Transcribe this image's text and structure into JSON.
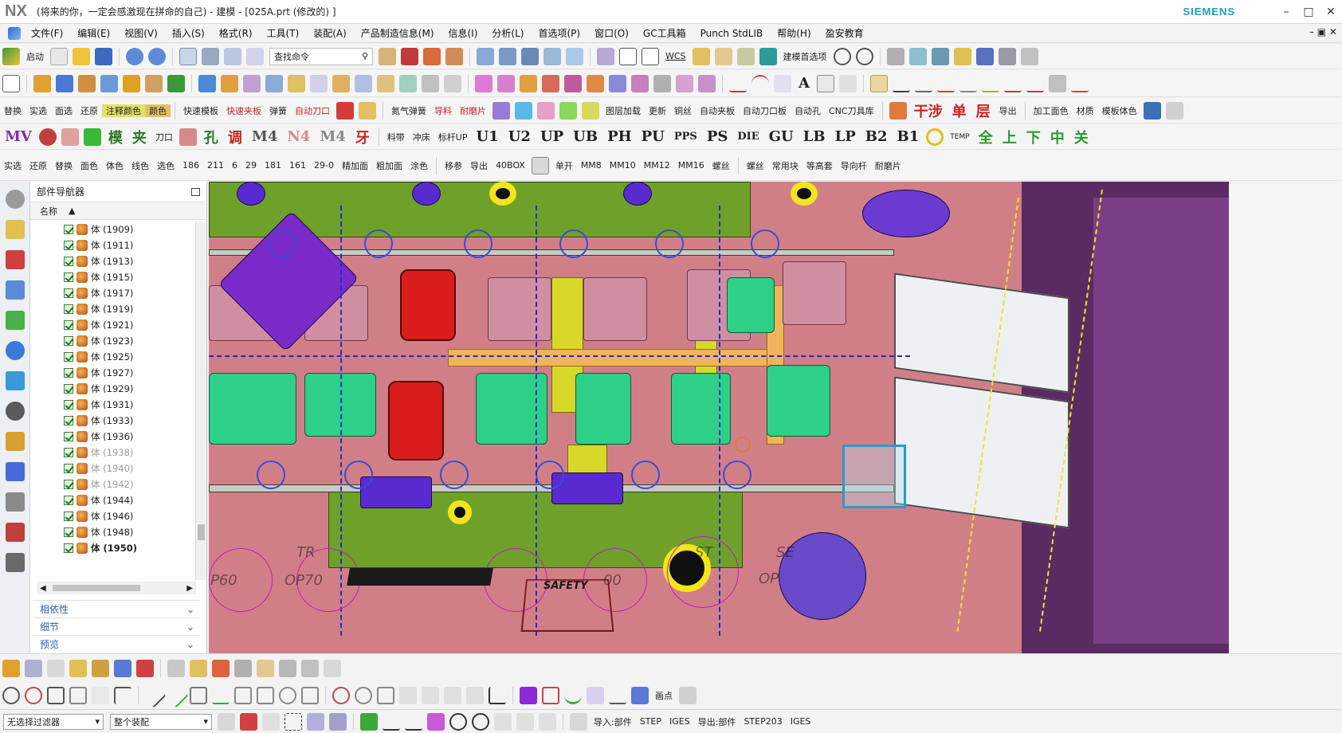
{
  "titlebar": {
    "logo": "NX",
    "title": "(将来的你，一定会感激现在拼命的自己) - 建模 - [025A.prt  (修改的) ]",
    "brand": "SIEMENS",
    "minimize": "–",
    "maximize": "□",
    "close": "✕"
  },
  "menu": {
    "items": [
      "文件(F)",
      "编辑(E)",
      "视图(V)",
      "插入(S)",
      "格式(R)",
      "工具(T)",
      "装配(A)",
      "产品制造信息(M)",
      "信息(I)",
      "分析(L)",
      "首选项(P)",
      "窗口(O)",
      "GC工具箱",
      "Punch StdLIB",
      "帮助(H)",
      "盈安教育"
    ],
    "restore": "– ▣ ✕"
  },
  "toolbar1": {
    "start_label": "启动",
    "search_placeholder": "查找命令",
    "wcs_label": "WCS",
    "prefs_label": "建模首选项"
  },
  "toolbar3": {
    "labels": [
      "替换",
      "实选",
      "面选",
      "还原",
      "注释颜色",
      "颜色",
      "快速模板",
      "快速夹板",
      "弹簧",
      "自动刀口",
      "氮气弹簧",
      "导料",
      "耐磨片",
      "图层加载",
      "更新",
      "铜丝",
      "自动夹板",
      "自动刀口板",
      "自动孔",
      "CNC刀具库",
      "干涉",
      "单",
      "层",
      "导出",
      "加工面色",
      "材质",
      "模板体色"
    ]
  },
  "toolbar4": {
    "labels": [
      "MV",
      "模",
      "夹",
      "刀口",
      "调",
      "M4",
      "N4",
      "M4",
      "孔",
      "牙",
      "料带",
      "冲床",
      "标杆UP",
      "U1",
      "U2",
      "UP",
      "UB",
      "PH",
      "PU",
      "PPS",
      "PS",
      "DIE",
      "GU",
      "LB",
      "LP",
      "B2",
      "B1",
      "TEMP",
      "全",
      "上",
      "下",
      "中",
      "关"
    ]
  },
  "toolbar5": {
    "labels": [
      "实选",
      "还原",
      "替换",
      "面色",
      "体色",
      "线色",
      "选色",
      "186",
      "211",
      "6",
      "29",
      "181",
      "161",
      "29-0",
      "精加面",
      "粗加面",
      "涂色",
      "移参",
      "导出",
      "40BOX",
      "单开",
      "MM8",
      "MM10",
      "MM12",
      "MM16",
      "螺丝",
      "螺丝",
      "常用块",
      "等高套",
      "导向杆",
      "耐磨片"
    ]
  },
  "navigator": {
    "title": "部件导航器",
    "column_name": "名称",
    "rows": [
      {
        "label": "体 (1909)",
        "state": "normal"
      },
      {
        "label": "体 (1911)",
        "state": "normal"
      },
      {
        "label": "体 (1913)",
        "state": "normal"
      },
      {
        "label": "体 (1915)",
        "state": "normal"
      },
      {
        "label": "体 (1917)",
        "state": "normal"
      },
      {
        "label": "体 (1919)",
        "state": "normal"
      },
      {
        "label": "体 (1921)",
        "state": "normal"
      },
      {
        "label": "体 (1923)",
        "state": "normal"
      },
      {
        "label": "体 (1925)",
        "state": "normal"
      },
      {
        "label": "体 (1927)",
        "state": "normal"
      },
      {
        "label": "体 (1929)",
        "state": "normal"
      },
      {
        "label": "体 (1931)",
        "state": "normal"
      },
      {
        "label": "体 (1933)",
        "state": "normal"
      },
      {
        "label": "体 (1936)",
        "state": "normal"
      },
      {
        "label": "体 (1938)",
        "state": "dim"
      },
      {
        "label": "体 (1940)",
        "state": "dim"
      },
      {
        "label": "体 (1942)",
        "state": "dim"
      },
      {
        "label": "体 (1944)",
        "state": "normal"
      },
      {
        "label": "体 (1946)",
        "state": "normal"
      },
      {
        "label": "体 (1948)",
        "state": "normal"
      },
      {
        "label": "体 (1950)",
        "state": "selected"
      }
    ],
    "sections": [
      "相依性",
      "细节",
      "预览"
    ]
  },
  "viewport": {
    "labels": [
      "TR",
      "OP70",
      "P60",
      "OP",
      "SAFETY",
      "ST",
      "SE",
      "00"
    ]
  },
  "bottom": {
    "filter_value": "无选择过滤器",
    "scope_value": "整个装配",
    "import_label": "导入:部件",
    "step_label": "STEP",
    "iges_label": "IGES",
    "export_label": "导出:部件",
    "step203_label": "STEP203",
    "iges2_label": "IGES",
    "draw_label": "画点"
  },
  "colors": {
    "viewport_bg": "#d17f87",
    "accent": "#1a9fb5"
  }
}
